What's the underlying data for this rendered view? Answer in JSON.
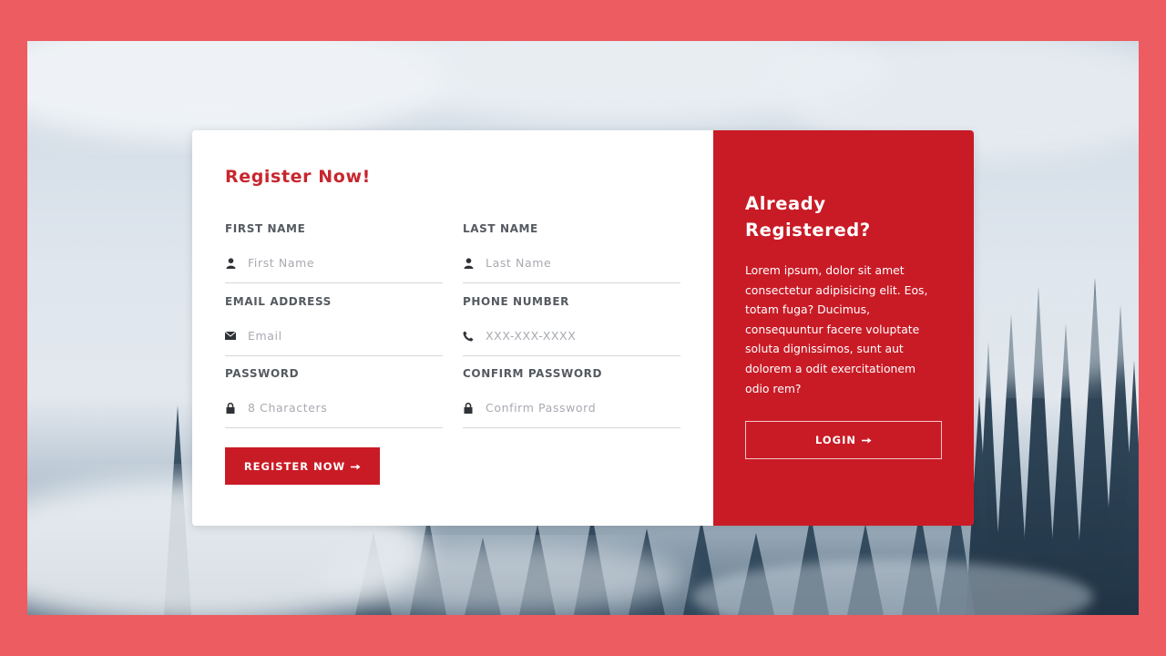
{
  "background": {
    "frame_color": "#ec5c60",
    "scene": "misty-forest-photo"
  },
  "register_form": {
    "title": "Register Now!",
    "fields": {
      "first_name": {
        "label": "FIRST NAME",
        "placeholder": "First Name",
        "value": "",
        "icon": "user-icon"
      },
      "last_name": {
        "label": "LAST NAME",
        "placeholder": "Last Name",
        "value": "",
        "icon": "user-icon"
      },
      "email": {
        "label": "EMAIL ADDRESS",
        "placeholder": "Email",
        "value": "",
        "icon": "envelope-icon"
      },
      "phone": {
        "label": "PHONE NUMBER",
        "placeholder": "XXX-XXX-XXXX",
        "value": "",
        "icon": "phone-icon"
      },
      "password": {
        "label": "PASSWORD",
        "placeholder": "8 Characters",
        "value": "",
        "icon": "lock-icon"
      },
      "confirm_password": {
        "label": "CONFIRM PASSWORD",
        "placeholder": "Confirm Password",
        "value": "",
        "icon": "lock-icon"
      }
    },
    "submit_label": "REGISTER NOW",
    "submit_icon": "arrow-right-icon"
  },
  "login_panel": {
    "title_line1": "Already",
    "title_line2": "Registered?",
    "text": "Lorem ipsum, dolor sit amet consectetur adipisicing elit. Eos, totam fuga? Ducimus, consequuntur facere voluptate soluta dignissimos, sunt aut dolorem a odit exercitationem odio rem?",
    "button_label": "LOGIN",
    "button_icon": "arrow-right-icon"
  },
  "colors": {
    "accent": "#c91b26",
    "title_red": "#c8262e",
    "label_gray": "#555a60",
    "placeholder_gray": "#a7aab0"
  }
}
